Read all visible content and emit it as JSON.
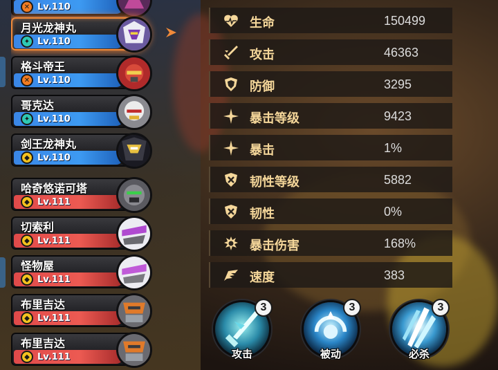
{
  "roster": [
    {
      "name": "",
      "level": "Lv.110",
      "bar": "blue",
      "class_icon": "orange-x-icon",
      "portrait": "robot-portrait-partial",
      "selected": false
    },
    {
      "name": "月光龙神丸",
      "level": "Lv.110",
      "bar": "blue",
      "class_icon": "teal-gear-icon",
      "portrait": "purple-dragon-robot",
      "selected": true
    },
    {
      "name": "格斗帝王",
      "level": "Lv.110",
      "bar": "blue",
      "class_icon": "orange-x-icon",
      "portrait": "red-fighter-robot",
      "selected": false
    },
    {
      "name": "哥克达",
      "level": "Lv.110",
      "bar": "blue",
      "class_icon": "teal-gear-icon",
      "portrait": "white-red-robot",
      "selected": false
    },
    {
      "name": "剑王龙神丸",
      "level": "Lv.110",
      "bar": "blue",
      "class_icon": "gold-shield-icon",
      "portrait": "black-gold-dragon-robot",
      "selected": false
    },
    {
      "name": "哈奇悠诺可塔",
      "level": "Lv.111",
      "bar": "red",
      "class_icon": "gold-shield-icon",
      "portrait": "grey-green-robot",
      "selected": false
    },
    {
      "name": "切索利",
      "level": "Lv.111",
      "bar": "red",
      "class_icon": "gold-shield-icon",
      "portrait": "purple-white-monster",
      "selected": false
    },
    {
      "name": "怪物屋",
      "level": "Lv.111",
      "bar": "red",
      "class_icon": "gold-shield-icon",
      "portrait": "purple-white-monster",
      "selected": false
    },
    {
      "name": "布里吉达",
      "level": "Lv.111",
      "bar": "red",
      "class_icon": "gold-shield-icon",
      "portrait": "orange-grey-robot",
      "selected": false
    },
    {
      "name": "布里吉达",
      "level": "Lv.111",
      "bar": "red",
      "class_icon": "gold-shield-icon",
      "portrait": "orange-grey-robot",
      "selected": false
    }
  ],
  "stats": [
    {
      "label": "生命",
      "value": "150499",
      "icon": "heart-icon"
    },
    {
      "label": "攻击",
      "value": "46363",
      "icon": "sword-icon"
    },
    {
      "label": "防御",
      "value": "3295",
      "icon": "shield-icon"
    },
    {
      "label": "暴击等级",
      "value": "9423",
      "icon": "crit-star-icon"
    },
    {
      "label": "暴击",
      "value": "1%",
      "icon": "crit-star-icon"
    },
    {
      "label": "韧性等级",
      "value": "5882",
      "icon": "tough-shield-icon"
    },
    {
      "label": "韧性",
      "value": "0%",
      "icon": "tough-shield-icon"
    },
    {
      "label": "暴击伤害",
      "value": "168%",
      "icon": "crit-damage-icon"
    },
    {
      "label": "速度",
      "value": "383",
      "icon": "wing-icon"
    }
  ],
  "skills": [
    {
      "label": "攻击",
      "level": "3",
      "icon": "attack-skill-icon"
    },
    {
      "label": "被动",
      "level": "3",
      "icon": "passive-skill-icon"
    },
    {
      "label": "必杀",
      "level": "3",
      "icon": "ultimate-skill-icon"
    }
  ],
  "colors": {
    "stat_label": "#f5d79a",
    "stat_value": "#dcdcdc",
    "level_bar_blue": "#3d9af2",
    "level_bar_red": "#ec5a52",
    "selected_glow": "#f08a3a"
  }
}
